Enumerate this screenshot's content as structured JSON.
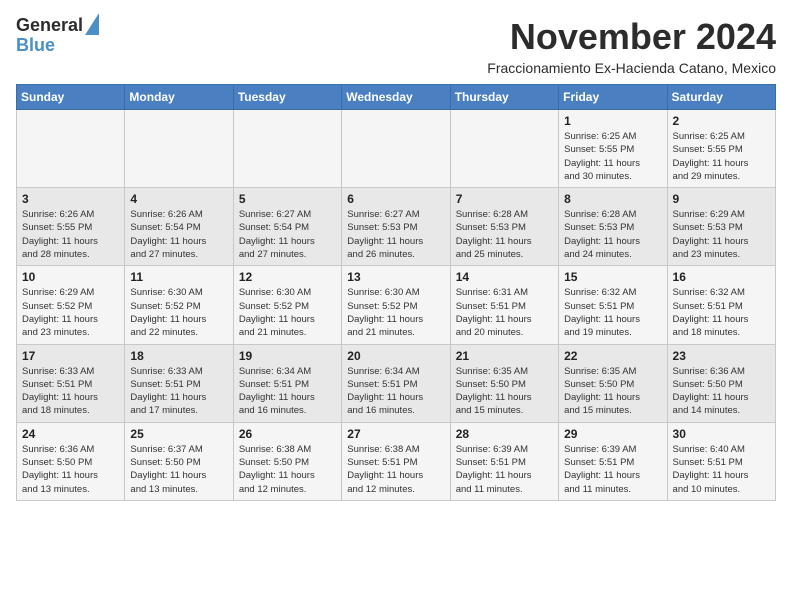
{
  "header": {
    "logo_line1": "General",
    "logo_line2": "Blue",
    "month": "November 2024",
    "location": "Fraccionamiento Ex-Hacienda Catano, Mexico"
  },
  "weekdays": [
    "Sunday",
    "Monday",
    "Tuesday",
    "Wednesday",
    "Thursday",
    "Friday",
    "Saturday"
  ],
  "weeks": [
    [
      {
        "day": "",
        "info": ""
      },
      {
        "day": "",
        "info": ""
      },
      {
        "day": "",
        "info": ""
      },
      {
        "day": "",
        "info": ""
      },
      {
        "day": "",
        "info": ""
      },
      {
        "day": "1",
        "info": "Sunrise: 6:25 AM\nSunset: 5:55 PM\nDaylight: 11 hours\nand 30 minutes."
      },
      {
        "day": "2",
        "info": "Sunrise: 6:25 AM\nSunset: 5:55 PM\nDaylight: 11 hours\nand 29 minutes."
      }
    ],
    [
      {
        "day": "3",
        "info": "Sunrise: 6:26 AM\nSunset: 5:55 PM\nDaylight: 11 hours\nand 28 minutes."
      },
      {
        "day": "4",
        "info": "Sunrise: 6:26 AM\nSunset: 5:54 PM\nDaylight: 11 hours\nand 27 minutes."
      },
      {
        "day": "5",
        "info": "Sunrise: 6:27 AM\nSunset: 5:54 PM\nDaylight: 11 hours\nand 27 minutes."
      },
      {
        "day": "6",
        "info": "Sunrise: 6:27 AM\nSunset: 5:53 PM\nDaylight: 11 hours\nand 26 minutes."
      },
      {
        "day": "7",
        "info": "Sunrise: 6:28 AM\nSunset: 5:53 PM\nDaylight: 11 hours\nand 25 minutes."
      },
      {
        "day": "8",
        "info": "Sunrise: 6:28 AM\nSunset: 5:53 PM\nDaylight: 11 hours\nand 24 minutes."
      },
      {
        "day": "9",
        "info": "Sunrise: 6:29 AM\nSunset: 5:53 PM\nDaylight: 11 hours\nand 23 minutes."
      }
    ],
    [
      {
        "day": "10",
        "info": "Sunrise: 6:29 AM\nSunset: 5:52 PM\nDaylight: 11 hours\nand 23 minutes."
      },
      {
        "day": "11",
        "info": "Sunrise: 6:30 AM\nSunset: 5:52 PM\nDaylight: 11 hours\nand 22 minutes."
      },
      {
        "day": "12",
        "info": "Sunrise: 6:30 AM\nSunset: 5:52 PM\nDaylight: 11 hours\nand 21 minutes."
      },
      {
        "day": "13",
        "info": "Sunrise: 6:30 AM\nSunset: 5:52 PM\nDaylight: 11 hours\nand 21 minutes."
      },
      {
        "day": "14",
        "info": "Sunrise: 6:31 AM\nSunset: 5:51 PM\nDaylight: 11 hours\nand 20 minutes."
      },
      {
        "day": "15",
        "info": "Sunrise: 6:32 AM\nSunset: 5:51 PM\nDaylight: 11 hours\nand 19 minutes."
      },
      {
        "day": "16",
        "info": "Sunrise: 6:32 AM\nSunset: 5:51 PM\nDaylight: 11 hours\nand 18 minutes."
      }
    ],
    [
      {
        "day": "17",
        "info": "Sunrise: 6:33 AM\nSunset: 5:51 PM\nDaylight: 11 hours\nand 18 minutes."
      },
      {
        "day": "18",
        "info": "Sunrise: 6:33 AM\nSunset: 5:51 PM\nDaylight: 11 hours\nand 17 minutes."
      },
      {
        "day": "19",
        "info": "Sunrise: 6:34 AM\nSunset: 5:51 PM\nDaylight: 11 hours\nand 16 minutes."
      },
      {
        "day": "20",
        "info": "Sunrise: 6:34 AM\nSunset: 5:51 PM\nDaylight: 11 hours\nand 16 minutes."
      },
      {
        "day": "21",
        "info": "Sunrise: 6:35 AM\nSunset: 5:50 PM\nDaylight: 11 hours\nand 15 minutes."
      },
      {
        "day": "22",
        "info": "Sunrise: 6:35 AM\nSunset: 5:50 PM\nDaylight: 11 hours\nand 15 minutes."
      },
      {
        "day": "23",
        "info": "Sunrise: 6:36 AM\nSunset: 5:50 PM\nDaylight: 11 hours\nand 14 minutes."
      }
    ],
    [
      {
        "day": "24",
        "info": "Sunrise: 6:36 AM\nSunset: 5:50 PM\nDaylight: 11 hours\nand 13 minutes."
      },
      {
        "day": "25",
        "info": "Sunrise: 6:37 AM\nSunset: 5:50 PM\nDaylight: 11 hours\nand 13 minutes."
      },
      {
        "day": "26",
        "info": "Sunrise: 6:38 AM\nSunset: 5:50 PM\nDaylight: 11 hours\nand 12 minutes."
      },
      {
        "day": "27",
        "info": "Sunrise: 6:38 AM\nSunset: 5:51 PM\nDaylight: 11 hours\nand 12 minutes."
      },
      {
        "day": "28",
        "info": "Sunrise: 6:39 AM\nSunset: 5:51 PM\nDaylight: 11 hours\nand 11 minutes."
      },
      {
        "day": "29",
        "info": "Sunrise: 6:39 AM\nSunset: 5:51 PM\nDaylight: 11 hours\nand 11 minutes."
      },
      {
        "day": "30",
        "info": "Sunrise: 6:40 AM\nSunset: 5:51 PM\nDaylight: 11 hours\nand 10 minutes."
      }
    ]
  ]
}
